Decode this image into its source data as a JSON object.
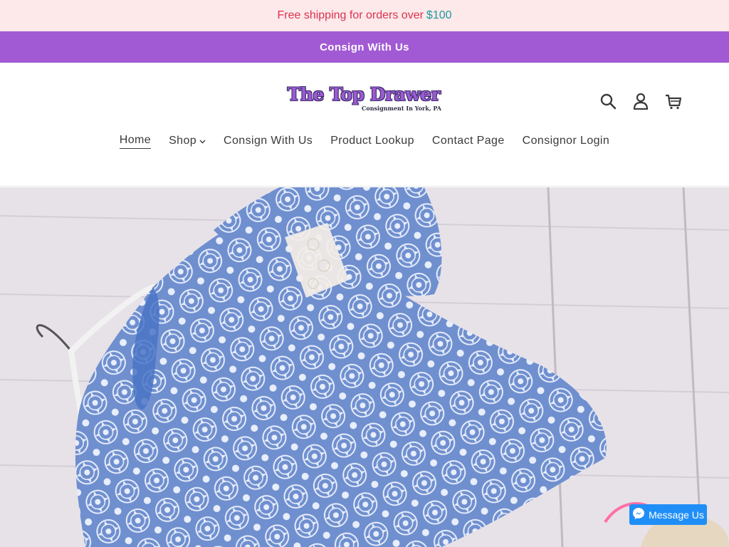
{
  "announcement": {
    "text": "Free shipping for orders over",
    "price": "$100"
  },
  "consign_bar": {
    "label": "Consign With Us"
  },
  "logo": {
    "title": "The Top Drawer",
    "subtitle": "Consignment In York, PA"
  },
  "header_icons": [
    "search-icon",
    "account-icon",
    "cart-icon"
  ],
  "nav": {
    "items": [
      {
        "label": "Home"
      },
      {
        "label": "Shop"
      },
      {
        "label": "Consign With Us"
      },
      {
        "label": "Product Lookup"
      },
      {
        "label": "Contact Page"
      },
      {
        "label": "Consignor Login"
      }
    ]
  },
  "messenger": {
    "label": "Message Us"
  },
  "colors": {
    "announce_bg": "#fde8ea",
    "announce_text": "#d9334f",
    "price_text": "#1e9a9a",
    "consign_bar_bg": "#a15ad4",
    "messenger_bg": "#1f8ff7"
  }
}
